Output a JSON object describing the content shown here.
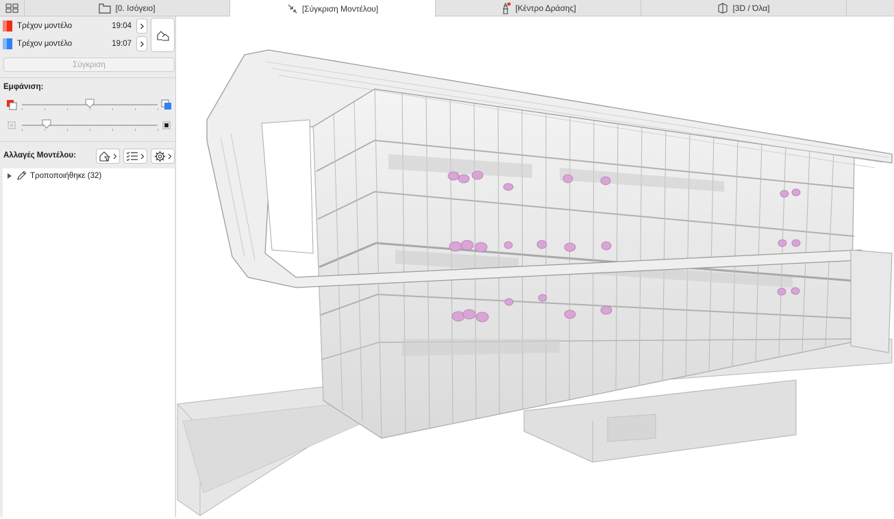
{
  "tabs": [
    {
      "label": "[0. Ισόγειο]",
      "icon": "floor-plan-icon"
    },
    {
      "label": "[Σύγκριση Μοντέλου]",
      "icon": "compare-arrows-icon",
      "active": true
    },
    {
      "label": "[Κέντρο Δράσης]",
      "icon": "lighthouse-icon"
    },
    {
      "label": "[3D / Όλα]",
      "icon": "3d-box-icon"
    }
  ],
  "models": [
    {
      "name": "Τρέχον μοντέλο",
      "time": "19:04",
      "color_light": "#f77f73",
      "color": "#f12d12"
    },
    {
      "name": "Τρέχον μοντέλο",
      "time": "19:07",
      "color_light": "#85b8f3",
      "color": "#2d83f1"
    }
  ],
  "compare_button": "Σύγκριση",
  "display_label": "Εμφάνιση:",
  "sliders": [
    {
      "name": "color-mix-slider",
      "value": 0.5
    },
    {
      "name": "opacity-slider",
      "value": 0.18
    }
  ],
  "changes_label": "Αλλαγές Μοντέλου:",
  "tree": [
    {
      "label": "Τροποποιήθηκε (32)",
      "icon": "pencil-icon",
      "expanded": false
    }
  ],
  "colors": {
    "accent_red": "#f12d12",
    "accent_blue": "#2d83f1",
    "change_highlight": "#d9a5d6"
  }
}
